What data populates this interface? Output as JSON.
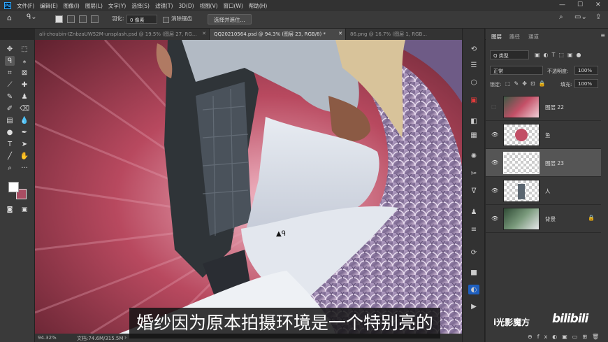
{
  "menu": {
    "logo": "Ps",
    "items": [
      "文件(F)",
      "编辑(E)",
      "图像(I)",
      "图层(L)",
      "文字(Y)",
      "选择(S)",
      "滤镜(T)",
      "3D(D)",
      "视图(V)",
      "窗口(W)",
      "帮助(H)"
    ]
  },
  "window": {
    "minimize": "—",
    "maximize": "☐",
    "close": "✕"
  },
  "options": {
    "feather_label": "羽化:",
    "feather_value": "0 像素",
    "antialias_label": "消除锯齿",
    "select_mask_button": "选择并遮住..."
  },
  "tabs": [
    {
      "label": "ali-choubin-IZnbzaUW52M-unsplash.psd @ 19.5% (图层 27, RG...",
      "close": "✕",
      "active": false
    },
    {
      "label": "QQ20210564.psd @ 94.3% (图层 23, RGB/8) *",
      "close": "✕",
      "active": true
    },
    {
      "label": "86.png @ 16.7% (图层 1, RGB...",
      "close": "✕",
      "active": false
    }
  ],
  "status": {
    "zoom": "94.32%",
    "doc": "文档:74.6M/315.5M"
  },
  "layers_panel": {
    "tabs": [
      "图层",
      "路径",
      "通道"
    ],
    "filter_label": "Q 类型",
    "blend_mode": "正常",
    "opacity_label": "不透明度:",
    "opacity_value": "100%",
    "lock_label": "锁定:",
    "fill_label": "填充:",
    "fill_value": "100%",
    "layers": [
      {
        "name": "图层 22",
        "visible": false,
        "selected": false
      },
      {
        "name": "鱼",
        "visible": true,
        "selected": false
      },
      {
        "name": "图层 23",
        "visible": true,
        "selected": true
      },
      {
        "name": "人",
        "visible": true,
        "selected": false
      },
      {
        "name": "背景",
        "visible": true,
        "selected": false,
        "locked": true
      }
    ]
  },
  "subtitle": "婚纱因为原本拍摄环境是一个特别亮的",
  "watermark": {
    "left": "i光影魔方",
    "right": "bilibili"
  },
  "colors": {
    "accent": "#31a8ff",
    "foreground": "#ffffff",
    "background": "#a84d63"
  }
}
